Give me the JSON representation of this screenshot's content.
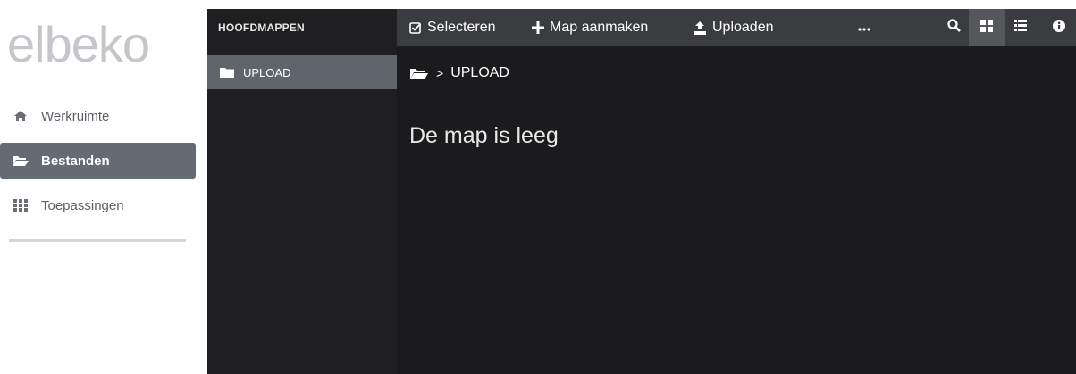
{
  "sidebar": {
    "logo": "elbeko",
    "items": [
      {
        "label": "Werkruimte",
        "icon": "home-icon",
        "active": false
      },
      {
        "label": "Bestanden",
        "icon": "folder-open-icon",
        "active": true
      },
      {
        "label": "Toepassingen",
        "icon": "grid-apps-icon",
        "active": false
      }
    ]
  },
  "tree": {
    "header": "HOOFDMAPPEN",
    "items": [
      {
        "label": "UPLOAD",
        "icon": "folder-icon",
        "selected": true
      }
    ]
  },
  "toolbar": {
    "select_label": "Selecteren",
    "new_folder_label": "Map aanmaken",
    "upload_label": "Uploaden",
    "more_icon": "more-icon",
    "search_icon": "search-icon",
    "grid_view_icon": "grid-view-icon",
    "list_view_icon": "list-view-icon",
    "info_icon": "info-icon"
  },
  "breadcrumb": {
    "separator": ">",
    "current": "UPLOAD"
  },
  "main": {
    "empty_message": "De map is leeg"
  },
  "colors": {
    "sidebar_active": "#656b72",
    "tree_bg": "#1f1f21",
    "tree_selected": "#5f656b",
    "toolbar_bg": "#3b3c3f",
    "main_bg": "#1b1b1d",
    "logo": "#c4c6ca"
  }
}
